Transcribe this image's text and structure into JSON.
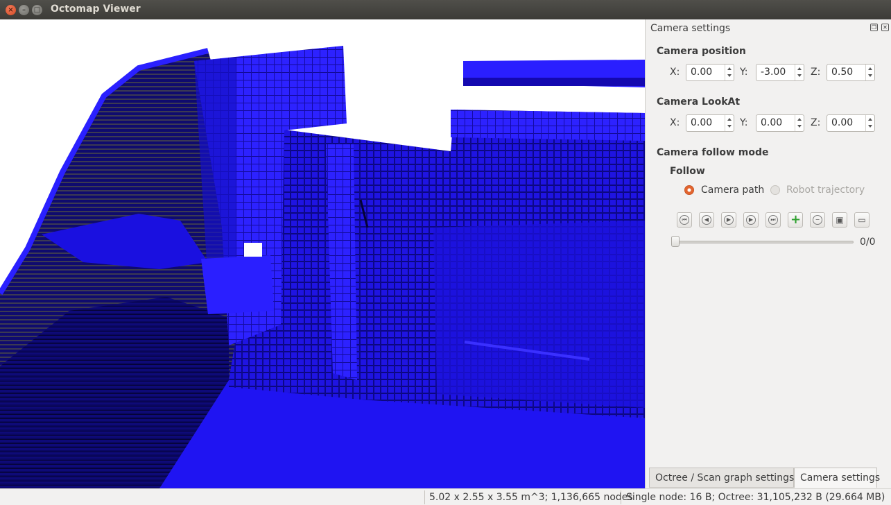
{
  "window": {
    "title": "Octomap Viewer"
  },
  "camera_panel": {
    "title": "Camera settings",
    "position": {
      "title": "Camera position",
      "x_label": "X:",
      "x": "0.00",
      "y_label": "Y:",
      "y": "-3.00",
      "z_label": "Z:",
      "z": "0.50"
    },
    "lookat": {
      "title": "Camera LookAt",
      "x_label": "X:",
      "x": "0.00",
      "y_label": "Y:",
      "y": "0.00",
      "z_label": "Z:",
      "z": "0.00"
    },
    "follow_mode": {
      "title": "Camera follow mode",
      "subtitle": "Follow",
      "option_camera_path": "Camera path",
      "option_robot_trajectory": "Robot trajectory",
      "selected": "Camera path"
    },
    "playback": {
      "buttons": [
        "first-frame-icon",
        "previous-frame-icon",
        "play-icon",
        "next-frame-icon",
        "last-frame-icon",
        "add-frame-icon",
        "remove-frame-icon",
        "save-icon",
        "clear-path-icon"
      ],
      "frame_counter": "0/0",
      "slider_position": 0
    }
  },
  "tabs": [
    {
      "label": "Octree / Scan graph settings",
      "active": false
    },
    {
      "label": "Camera settings",
      "active": true
    }
  ],
  "status": {
    "dimensions": "5.02 x 2.55 x 3.55 m^3; 1,136,665 nodes",
    "memory": "Single node: 16 B; Octree: 31,105,232 B (29.664 MB)"
  },
  "colors": {
    "voxel": "#1a0ff0",
    "voxel_dark": "#0b0870",
    "accent": "#e2642e",
    "add_button": "#2fa02f"
  }
}
